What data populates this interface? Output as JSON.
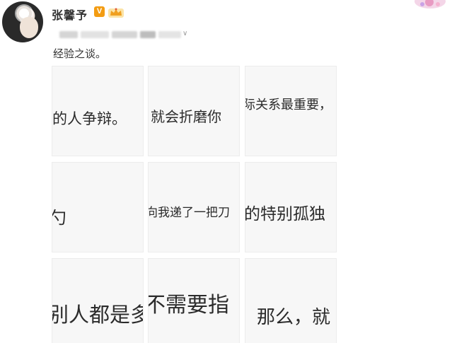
{
  "post": {
    "username": "张馨予",
    "verified_mark": "V",
    "text": "经验之谈。"
  },
  "images": [
    {
      "text": "的人争辩。"
    },
    {
      "text": "就会折磨你"
    },
    {
      "text": "际关系最重要，"
    },
    {
      "text": "勺"
    },
    {
      "text": "向我递了一把刀"
    },
    {
      "text": "的特别孤独"
    },
    {
      "text": "别人都是多"
    },
    {
      "text": "不需要指"
    },
    {
      "text": "那么，就"
    }
  ],
  "icons": {
    "avatar": "profile-photo",
    "verified": "verified-v-badge",
    "member": "crown-member-icon",
    "menu": "chevron-down-icon"
  },
  "colors": {
    "text": "#333333",
    "verified": "#f39c12",
    "tile_bg": "#f7f7f7"
  }
}
